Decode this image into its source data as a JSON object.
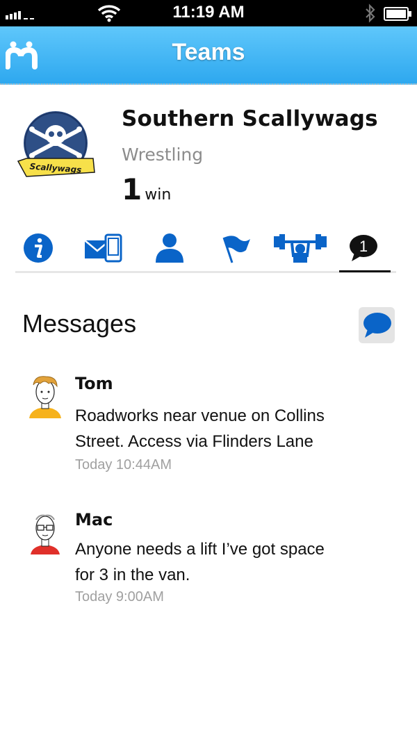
{
  "status_bar": {
    "time": "11:19 AM"
  },
  "nav": {
    "title": "Teams",
    "logo_icon": "app-logo-icon"
  },
  "team": {
    "name": "Southern Scallywags",
    "sport": "Wrestling",
    "record_count": "1",
    "record_unit": "win",
    "logo_text": "Scallywags"
  },
  "tabs": [
    {
      "icon": "info-icon",
      "active": false
    },
    {
      "icon": "message-phone-icon",
      "active": false
    },
    {
      "icon": "person-icon",
      "active": false
    },
    {
      "icon": "flag-icon",
      "active": false
    },
    {
      "icon": "weightlifter-icon",
      "active": false
    },
    {
      "icon": "chat-badge-icon",
      "badge": "1",
      "active": true
    }
  ],
  "messages_section": {
    "heading": "Messages",
    "compose_icon": "speech-bubble-icon"
  },
  "messages": [
    {
      "sender": "Tom",
      "body_line1": "Roadworks near venue on Collins",
      "body_line2": "Street.  Access via Flinders Lane",
      "time": "Today 10:44AM"
    },
    {
      "sender": "Mac",
      "body_line1": "Anyone needs a lift I’ve got space",
      "body_line2": "for 3 in the van.",
      "time": "Today 9:00AM"
    }
  ],
  "colors": {
    "nav_gradient_top": "#5fc7fb",
    "nav_gradient_bottom": "#2ea8ef",
    "icon_blue": "#0a64c8",
    "muted_text": "#8c8c8c"
  }
}
